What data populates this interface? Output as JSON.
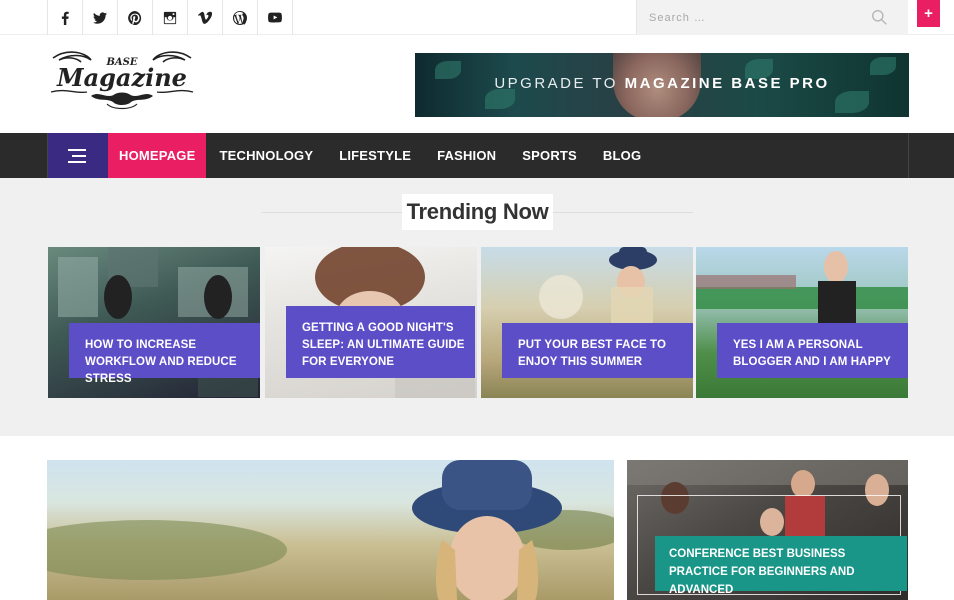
{
  "topbar": {
    "social_icons": [
      "facebook-icon",
      "twitter-icon",
      "pinterest-icon",
      "instagram-icon",
      "vimeo-icon",
      "wordpress-icon",
      "youtube-icon"
    ],
    "search_placeholder": "Search …",
    "plus_label": "+"
  },
  "header": {
    "logo": {
      "top": "BASE",
      "main": "Magazine"
    },
    "ad": {
      "text_light": "UPGRADE TO ",
      "text_bold": "MAGAZINE BASE PRO"
    }
  },
  "nav": {
    "items": [
      {
        "label": "HOMEPAGE",
        "active": true
      },
      {
        "label": "TECHNOLOGY"
      },
      {
        "label": "LIFESTYLE"
      },
      {
        "label": "FASHION"
      },
      {
        "label": "SPORTS"
      },
      {
        "label": "BLOG"
      }
    ]
  },
  "trending": {
    "title": "Trending Now",
    "cards": [
      {
        "title": "HOW TO INCREASE WORKFLOW AND REDUCE STRESS"
      },
      {
        "title": "GETTING A GOOD NIGHT'S SLEEP: AN ULTIMATE GUIDE FOR EVERYONE"
      },
      {
        "title": "PUT YOUR BEST FACE TO ENJOY THIS SUMMER"
      },
      {
        "title": "YES I AM A PERSONAL BLOGGER AND I AM HAPPY"
      }
    ]
  },
  "featured": {
    "side_title": "CONFERENCE BEST BUSINESS PRACTICE FOR BEGINNERS AND ADVANCED"
  },
  "colors": {
    "accent_pink": "#e91e63",
    "nav_dark": "#2b2b2b",
    "menu_purple": "#3a2a82",
    "caption_purple": "#5b4ec7",
    "caption_teal": "#1a9688"
  }
}
